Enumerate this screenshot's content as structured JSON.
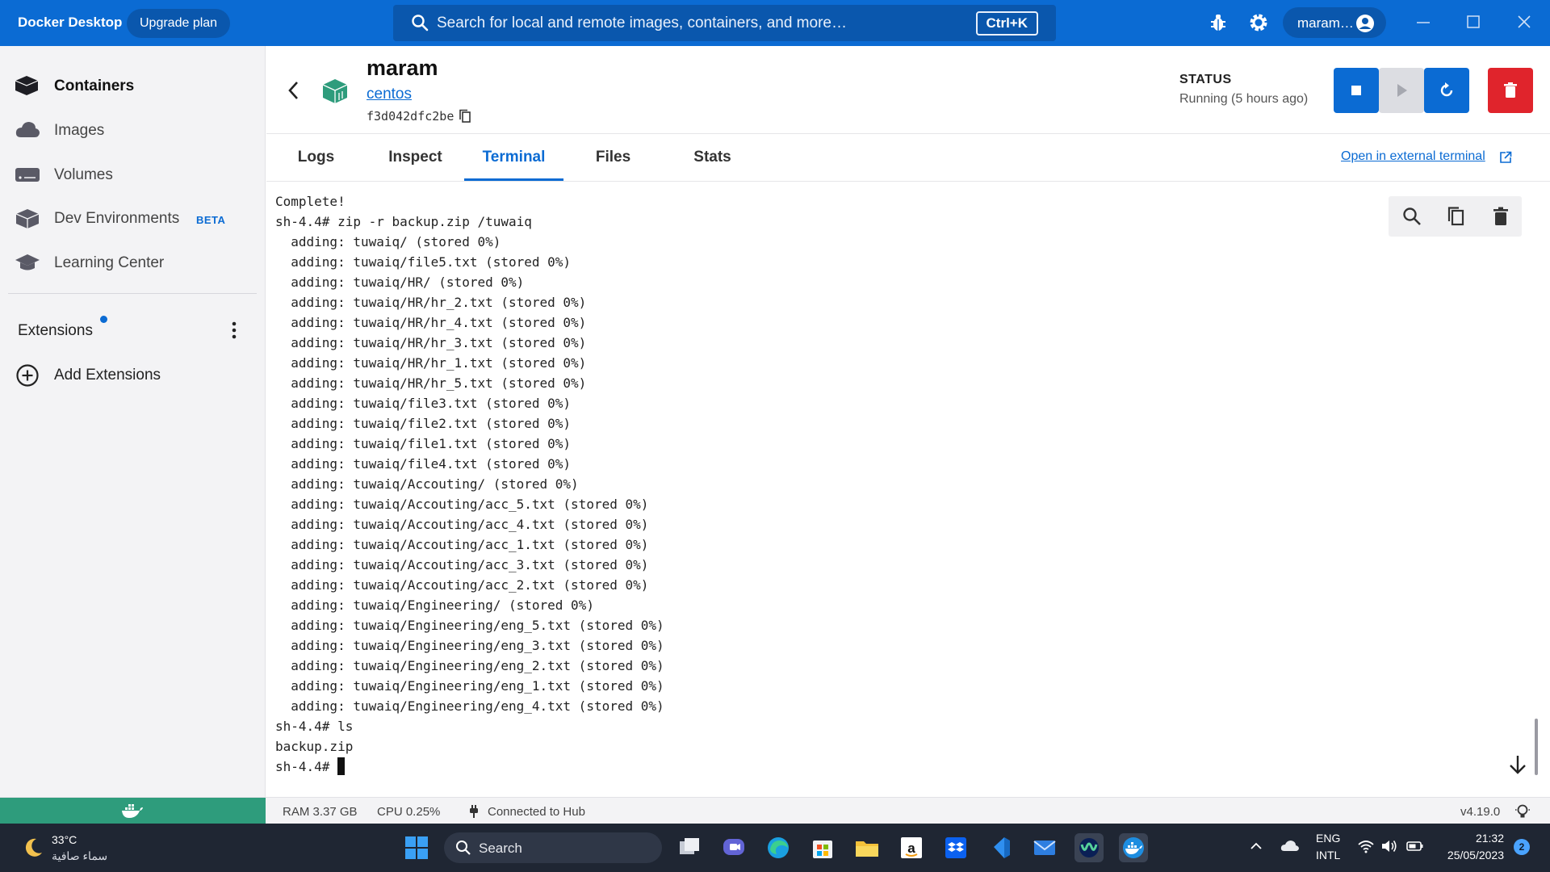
{
  "titlebar": {
    "brand": "Docker Desktop",
    "upgrade_label": "Upgrade plan",
    "search_placeholder": "Search for local and remote images, containers, and more…",
    "search_shortcut": "Ctrl+K",
    "user_name": "maram…",
    "icons": [
      "bug-icon",
      "gear-icon",
      "account-circle-icon",
      "minimize-icon",
      "maximize-icon",
      "close-icon"
    ]
  },
  "sidebar": {
    "items": [
      {
        "label": "Containers",
        "icon": "container-icon",
        "active": true
      },
      {
        "label": "Images",
        "icon": "cloud-icon"
      },
      {
        "label": "Volumes",
        "icon": "volume-icon"
      },
      {
        "label": "Dev Environments",
        "icon": "dev-env-icon",
        "badge": "BETA"
      },
      {
        "label": "Learning Center",
        "icon": "graduation-cap-icon"
      }
    ],
    "extensions_label": "Extensions",
    "add_extensions_label": "Add Extensions"
  },
  "container": {
    "name": "maram",
    "image": "centos",
    "id": "f3d042dfc2be",
    "status_label": "STATUS",
    "status_value": "Running (5 hours ago)",
    "accent": "#0b6bd3",
    "delete_color": "#e0242c"
  },
  "tabs": [
    {
      "label": "Logs"
    },
    {
      "label": "Inspect"
    },
    {
      "label": "Terminal",
      "active": true
    },
    {
      "label": "Files"
    },
    {
      "label": "Stats"
    }
  ],
  "open_external_label": "Open in external terminal",
  "terminal": {
    "lines": [
      "Complete!",
      "sh-4.4# zip -r backup.zip /tuwaiq",
      "  adding: tuwaiq/ (stored 0%)",
      "  adding: tuwaiq/file5.txt (stored 0%)",
      "  adding: tuwaiq/HR/ (stored 0%)",
      "  adding: tuwaiq/HR/hr_2.txt (stored 0%)",
      "  adding: tuwaiq/HR/hr_4.txt (stored 0%)",
      "  adding: tuwaiq/HR/hr_3.txt (stored 0%)",
      "  adding: tuwaiq/HR/hr_1.txt (stored 0%)",
      "  adding: tuwaiq/HR/hr_5.txt (stored 0%)",
      "  adding: tuwaiq/file3.txt (stored 0%)",
      "  adding: tuwaiq/file2.txt (stored 0%)",
      "  adding: tuwaiq/file1.txt (stored 0%)",
      "  adding: tuwaiq/file4.txt (stored 0%)",
      "  adding: tuwaiq/Accouting/ (stored 0%)",
      "  adding: tuwaiq/Accouting/acc_5.txt (stored 0%)",
      "  adding: tuwaiq/Accouting/acc_4.txt (stored 0%)",
      "  adding: tuwaiq/Accouting/acc_1.txt (stored 0%)",
      "  adding: tuwaiq/Accouting/acc_3.txt (stored 0%)",
      "  adding: tuwaiq/Accouting/acc_2.txt (stored 0%)",
      "  adding: tuwaiq/Engineering/ (stored 0%)",
      "  adding: tuwaiq/Engineering/eng_5.txt (stored 0%)",
      "  adding: tuwaiq/Engineering/eng_3.txt (stored 0%)",
      "  adding: tuwaiq/Engineering/eng_2.txt (stored 0%)",
      "  adding: tuwaiq/Engineering/eng_1.txt (stored 0%)",
      "  adding: tuwaiq/Engineering/eng_4.txt (stored 0%)",
      "sh-4.4# ls",
      "backup.zip"
    ],
    "prompt": "sh-4.4# "
  },
  "statusbar": {
    "ram": "RAM 3.37 GB",
    "cpu": "CPU 0.25%",
    "hub": "Connected to Hub",
    "version": "v4.19.0",
    "status_color": "#2e9c7c"
  },
  "taskbar": {
    "weather_temp": "33°C",
    "weather_desc": "سماء صافية",
    "search_label": "Search",
    "lang_line1": "ENG",
    "lang_line2": "INTL",
    "time": "21:32",
    "date": "25/05/2023",
    "notifications": "2"
  }
}
